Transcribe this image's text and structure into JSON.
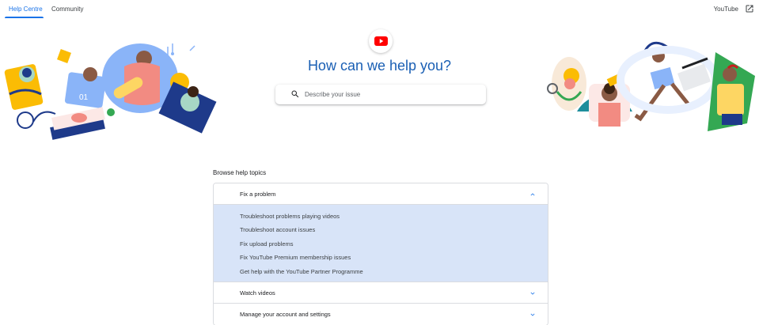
{
  "nav": {
    "tabs": [
      {
        "label": "Help Centre",
        "active": true
      },
      {
        "label": "Community",
        "active": false
      }
    ],
    "youtube_link": "YouTube",
    "external_icon": "open-in-new-icon"
  },
  "hero": {
    "logo_icon": "youtube-play-icon",
    "title": "How can we help you?",
    "search": {
      "placeholder": "Describe your issue",
      "value": "",
      "icon": "search-icon"
    }
  },
  "browse": {
    "title": "Browse help topics",
    "topics": [
      {
        "label": "Fix a problem",
        "expanded": true,
        "links": [
          "Troubleshoot problems playing videos",
          "Troubleshoot account issues",
          "Fix upload problems",
          "Fix YouTube Premium membership issues",
          "Get help with the YouTube Partner Programme"
        ]
      },
      {
        "label": "Watch videos",
        "expanded": false
      },
      {
        "label": "Manage your account and settings",
        "expanded": false
      }
    ]
  },
  "colors": {
    "accent": "#1a73e8",
    "title_blue": "#1a5fb4",
    "youtube_red": "#ff0000",
    "expanded_bg": "#d8e4f8"
  }
}
